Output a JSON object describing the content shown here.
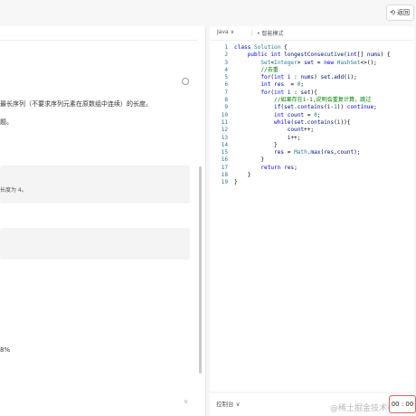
{
  "topbar": {
    "back_icon": "undo-icon",
    "back_label": "返回"
  },
  "problem": {
    "desc_line1": "最长序列（不要求序列元素在原数组中连续）的长度。",
    "desc_line2": "题。",
    "example_output_note": "长度为 4。",
    "stat_text": "8%"
  },
  "editor": {
    "language": "Java",
    "language_chevron": "∨",
    "smart_mode_icon": "bullet-icon",
    "smart_mode": "智能模式",
    "lines": [
      {
        "n": "1",
        "code": "class Solution {"
      },
      {
        "n": "2",
        "code": "    public int longestConsecutive(int[] nums) {"
      },
      {
        "n": "3",
        "code": "        Set<Integer> set = new HashSet<>();"
      },
      {
        "n": "4",
        "code": "        //去重"
      },
      {
        "n": "5",
        "code": "        for(int i : nums) set.add(i);"
      },
      {
        "n": "6",
        "code": "        int res  = 0;"
      },
      {
        "n": "7",
        "code": "        for(int i : set){"
      },
      {
        "n": "8",
        "code": "            //如果存在i-1,说明会重复计算，跳过"
      },
      {
        "n": "9",
        "code": "            if(set.contains(i-1)) continue;"
      },
      {
        "n": "10",
        "code": "            int count = 0;"
      },
      {
        "n": "11",
        "code": "            while(set.contains(i)){"
      },
      {
        "n": "12",
        "code": "                count++;"
      },
      {
        "n": "13",
        "code": "                i++;"
      },
      {
        "n": "14",
        "code": "            }"
      },
      {
        "n": "15",
        "code": "            res = Math.max(res,count);"
      },
      {
        "n": "16",
        "code": "        }"
      },
      {
        "n": "17",
        "code": "        return res;"
      },
      {
        "n": "18",
        "code": "    }"
      },
      {
        "n": "19",
        "code": "}"
      }
    ]
  },
  "bottom": {
    "console_label": "控制台",
    "console_chevron": "∨",
    "timer": "00 : 00",
    "watermark": "@稀土掘金技术社区"
  }
}
